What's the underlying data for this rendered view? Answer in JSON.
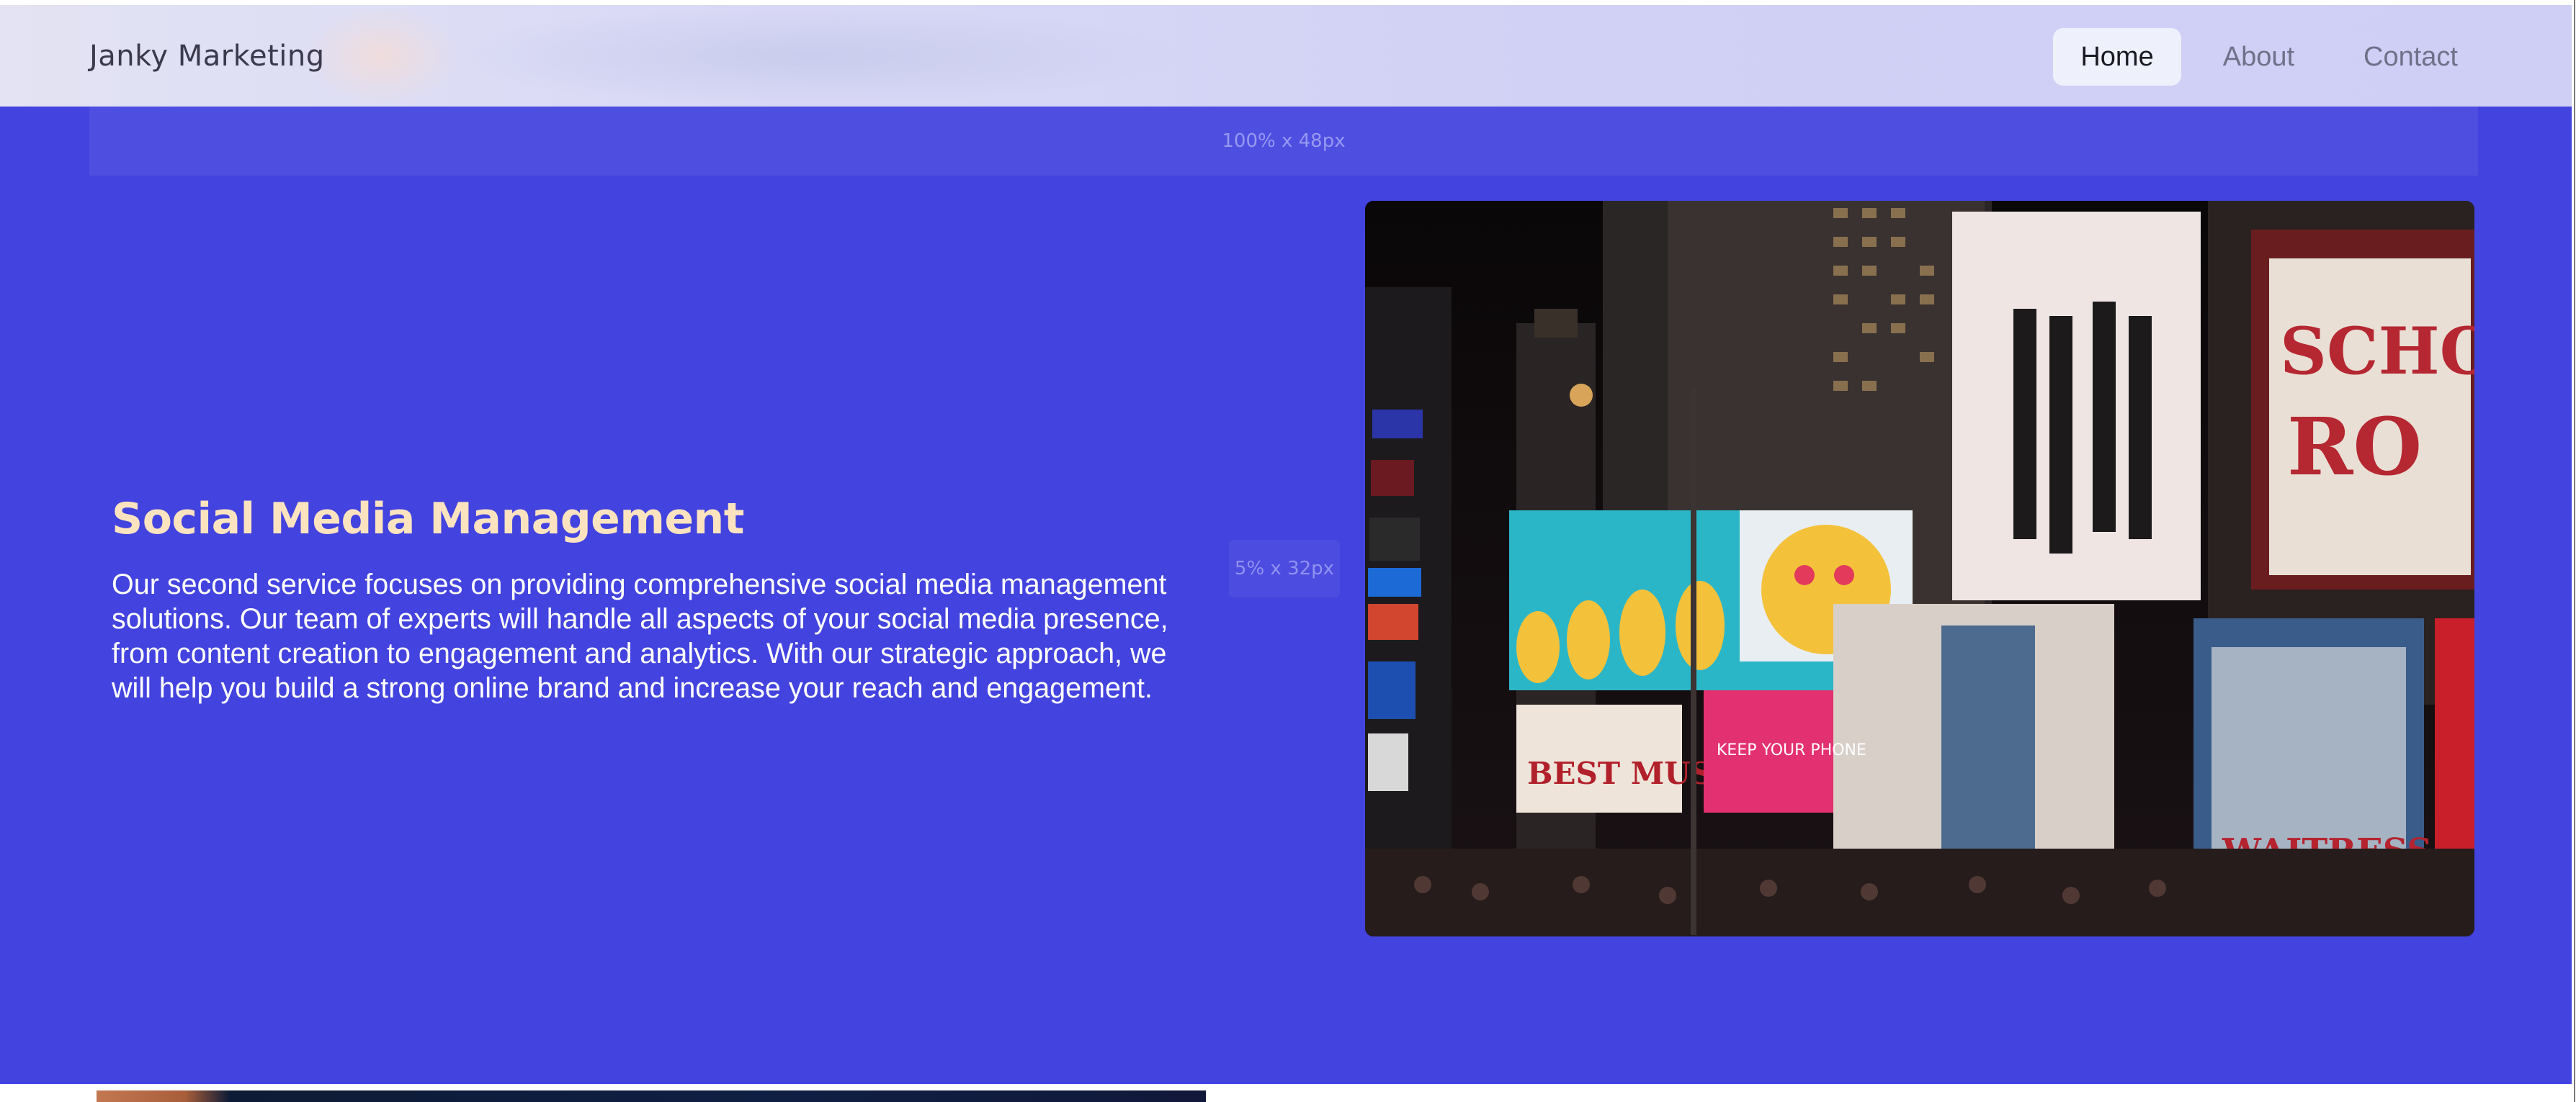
{
  "header": {
    "brand": "Janky Marketing",
    "nav": [
      {
        "label": "Home",
        "active": true
      },
      {
        "label": "About",
        "active": false
      },
      {
        "label": "Contact",
        "active": false
      }
    ]
  },
  "placeholders": {
    "top_bar_label": "100% x 48px",
    "gap_label": "5% x 32px"
  },
  "service": {
    "title": "Social Media Management",
    "description": "Our second service focuses on providing comprehensive social media management solutions. Our team of experts will handle all aspects of your social media presence, from content creation to engagement and analytics. With our strategic approach, we will help you build a strong online brand and increase your reach and engagement."
  },
  "image": {
    "subject": "Times Square billboards at night"
  },
  "colors": {
    "accent_blue": "#4343df",
    "heading": "#fbe3bf",
    "nav_active_bg": "#eef0fc"
  }
}
